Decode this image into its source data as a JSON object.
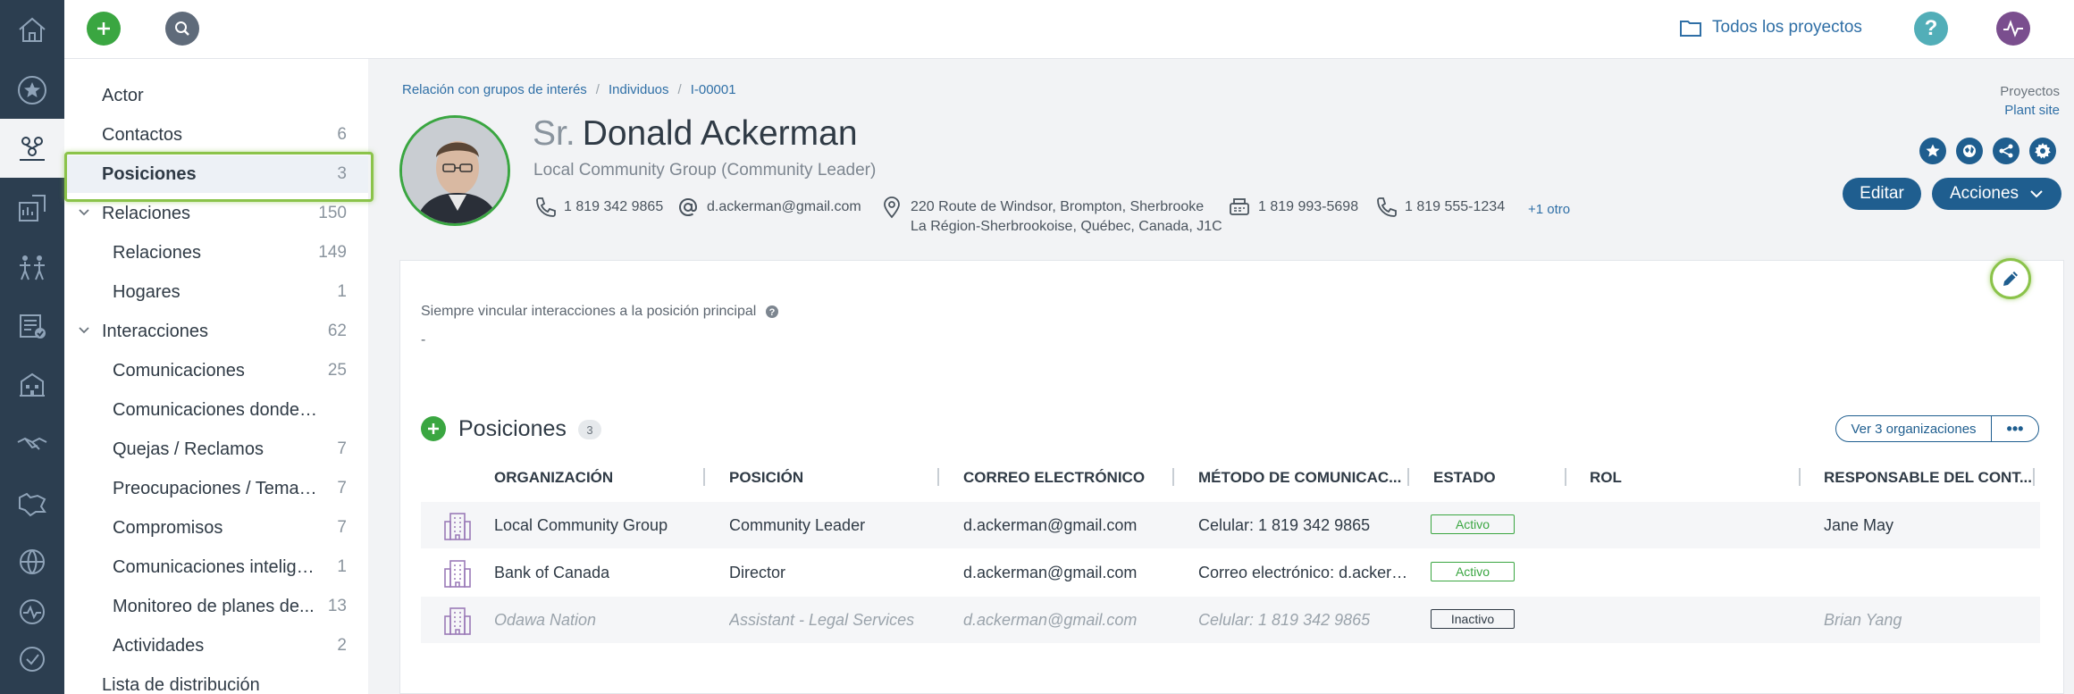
{
  "rail": {
    "icons": [
      "home-icon",
      "star-icon",
      "stakeholders-icon",
      "reports-icon",
      "people-icon",
      "tasks-icon",
      "buildings-icon",
      "handshake-icon",
      "map-icon",
      "globe-icon",
      "activity-icon",
      "check-icon"
    ],
    "active_index": 2
  },
  "topbar": {
    "projects_label": "Todos los proyectos",
    "help_label": "?"
  },
  "subnav": {
    "items": [
      {
        "label": "Actor",
        "count": "",
        "level": 0,
        "expandable": false
      },
      {
        "label": "Contactos",
        "count": "6",
        "level": 0,
        "expandable": false
      },
      {
        "label": "Posiciones",
        "count": "3",
        "level": 0,
        "expandable": false,
        "selected": true
      },
      {
        "label": "Relaciones",
        "count": "150",
        "level": 0,
        "expandable": true
      },
      {
        "label": "Relaciones",
        "count": "149",
        "level": 1,
        "expandable": false
      },
      {
        "label": "Hogares",
        "count": "1",
        "level": 1,
        "expandable": false
      },
      {
        "label": "Interacciones",
        "count": "62",
        "level": 0,
        "expandable": true
      },
      {
        "label": "Comunicaciones",
        "count": "25",
        "level": 1,
        "expandable": false
      },
      {
        "label": "Comunicaciones donde se m...",
        "count": "",
        "level": 1,
        "expandable": false
      },
      {
        "label": "Quejas / Reclamos",
        "count": "7",
        "level": 1,
        "expandable": false
      },
      {
        "label": "Preocupaciones / Temas...",
        "count": "7",
        "level": 1,
        "expandable": false
      },
      {
        "label": "Compromisos",
        "count": "7",
        "level": 1,
        "expandable": false
      },
      {
        "label": "Comunicaciones intelige...",
        "count": "1",
        "level": 1,
        "expandable": false
      },
      {
        "label": "Monitoreo de planes de...",
        "count": "13",
        "level": 1,
        "expandable": false
      },
      {
        "label": "Actividades",
        "count": "2",
        "level": 1,
        "expandable": false
      },
      {
        "label": "Lista de distribución",
        "count": "",
        "level": 0,
        "expandable": false
      }
    ]
  },
  "breadcrumb": {
    "items": [
      "Relación con grupos de interés",
      "Individuos",
      "I-00001"
    ],
    "separator": "/"
  },
  "project": {
    "label": "Proyectos",
    "value": "Plant site"
  },
  "person": {
    "salutation": "Sr.",
    "name": "Donald Ackerman",
    "subtitle": "Local Community Group (Community Leader)",
    "phone": "1 819 342 9865",
    "email": "d.ackerman@gmail.com",
    "address_line1": "220 Route de Windsor, Brompton, Sherbrooke",
    "address_line2": "La Région-Sherbrookoise, Québec, Canada, J1C",
    "fax": "1 819 993-5698",
    "phone2": "1 819 555-1234",
    "more": "+1 otro"
  },
  "actions": {
    "edit": "Editar",
    "acciones": "Acciones"
  },
  "field": {
    "label": "Siempre vincular interacciones a la posición principal",
    "value": "-"
  },
  "positions": {
    "title": "Posiciones",
    "count": "3",
    "orgs_button": "Ver 3 organizaciones",
    "more_button": "•••",
    "columns": [
      "ORGANIZACIÓN",
      "POSICIÓN",
      "CORREO ELECTRÓNICO",
      "MÉTODO DE COMUNICAC...",
      "ESTADO",
      "ROL",
      "RESPONSABLE DEL CONT..."
    ],
    "rows": [
      {
        "org": "Local Community Group",
        "position": "Community Leader",
        "email": "d.ackerman@gmail.com",
        "method": "Celular: 1 819 342 9865",
        "status": "Activo",
        "role": "",
        "owner": "Jane May",
        "inactive": false
      },
      {
        "org": "Bank of Canada",
        "position": "Director",
        "email": "d.ackerman@gmail.com",
        "method": "Correo electrónico: d.ackerm...",
        "status": "Activo",
        "role": "",
        "owner": "",
        "inactive": false
      },
      {
        "org": "Odawa Nation",
        "position": "Assistant - Legal Services",
        "email": "d.ackerman@gmail.com",
        "method": "Celular: 1 819 342 9865",
        "status": "Inactivo",
        "role": "",
        "owner": "Brian Yang",
        "inactive": true
      }
    ]
  },
  "colors": {
    "accent": "#1f5e8f",
    "green": "#3aa641",
    "highlight": "#8bc34a",
    "rail": "#2c3e50"
  }
}
